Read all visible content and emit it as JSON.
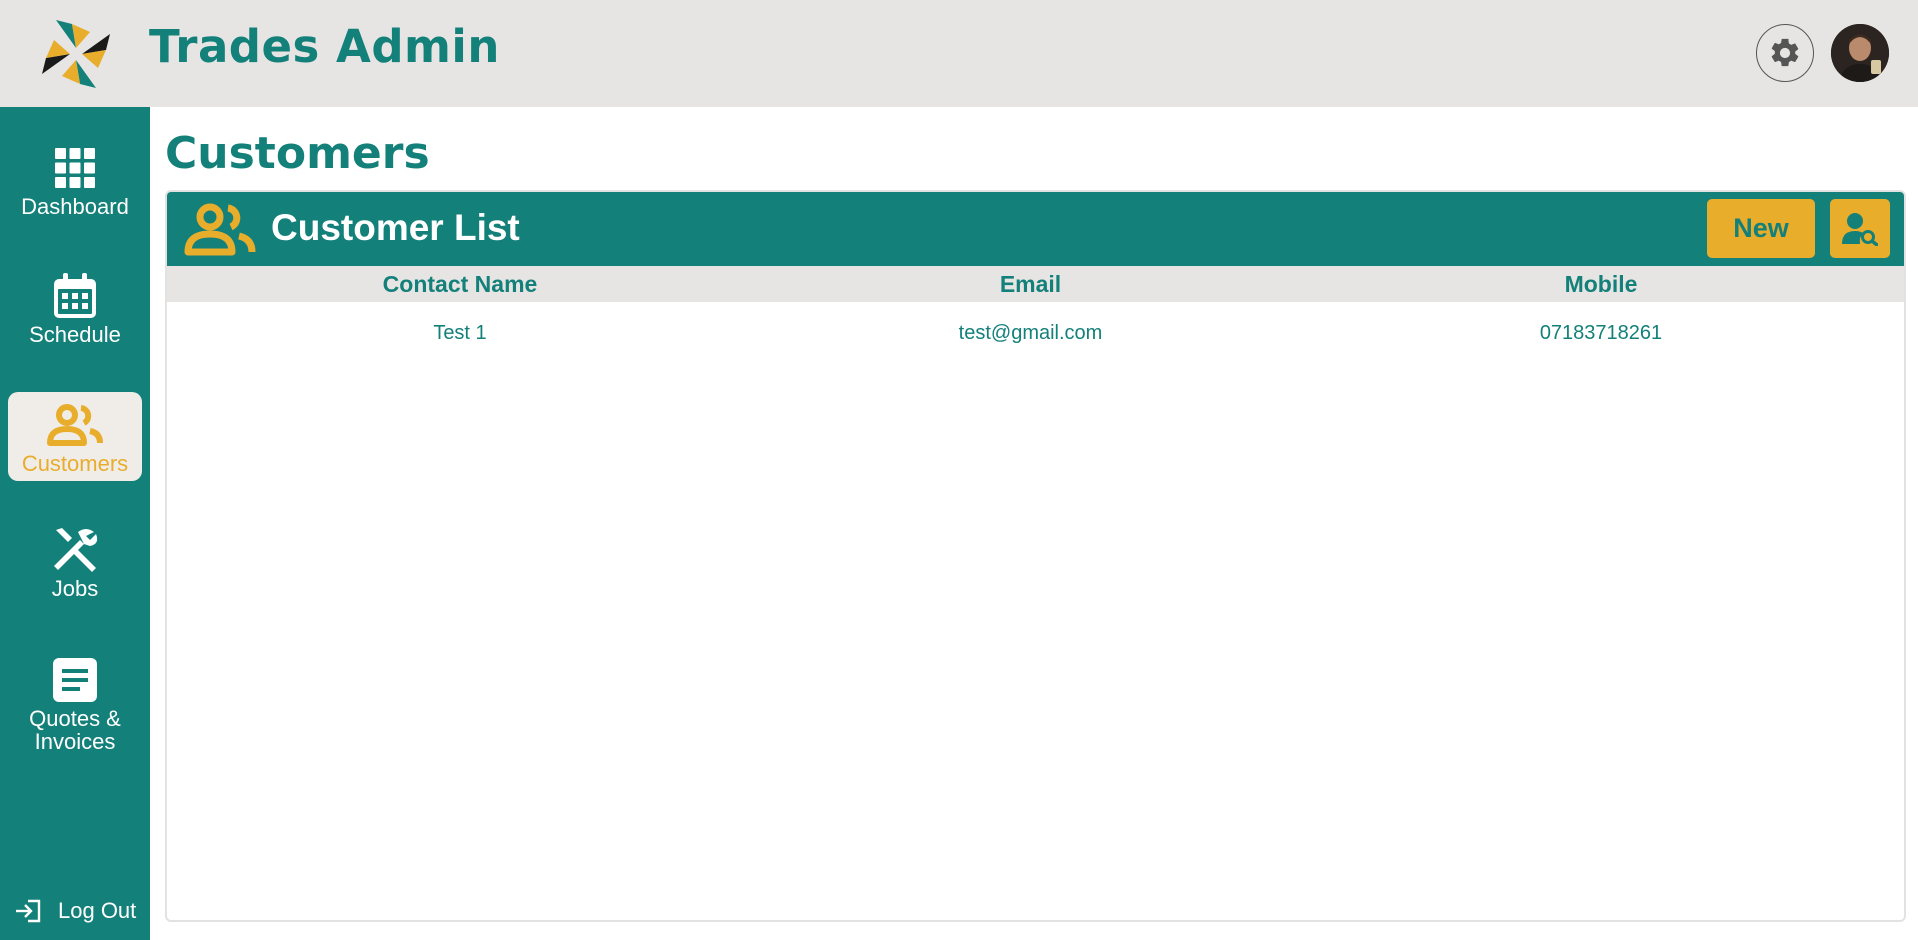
{
  "app": {
    "title": "Trades Admin",
    "accent": "#14807a",
    "highlight": "#e9ad2c"
  },
  "header": {
    "settings_icon": "gear-icon",
    "avatar": "user-avatar"
  },
  "sidebar": {
    "items": [
      {
        "label": "Dashboard",
        "icon": "grid-icon",
        "active": false
      },
      {
        "label": "Schedule",
        "icon": "calendar-icon",
        "active": false
      },
      {
        "label": "Customers",
        "icon": "users-icon",
        "active": true
      },
      {
        "label": "Jobs",
        "icon": "tools-icon",
        "active": false
      },
      {
        "label": "Quotes &\nInvoices",
        "icon": "document-icon",
        "active": false
      }
    ],
    "logout": {
      "label": "Log Out",
      "icon": "logout-icon"
    }
  },
  "page": {
    "title": "Customers"
  },
  "panel": {
    "title": "Customer List",
    "icon": "users-icon",
    "new_label": "New",
    "search_icon": "user-search-icon",
    "table": {
      "columns": [
        "Contact Name",
        "Email",
        "Mobile"
      ],
      "rows": [
        [
          "Test 1",
          "test@gmail.com",
          "07183718261"
        ]
      ]
    }
  }
}
